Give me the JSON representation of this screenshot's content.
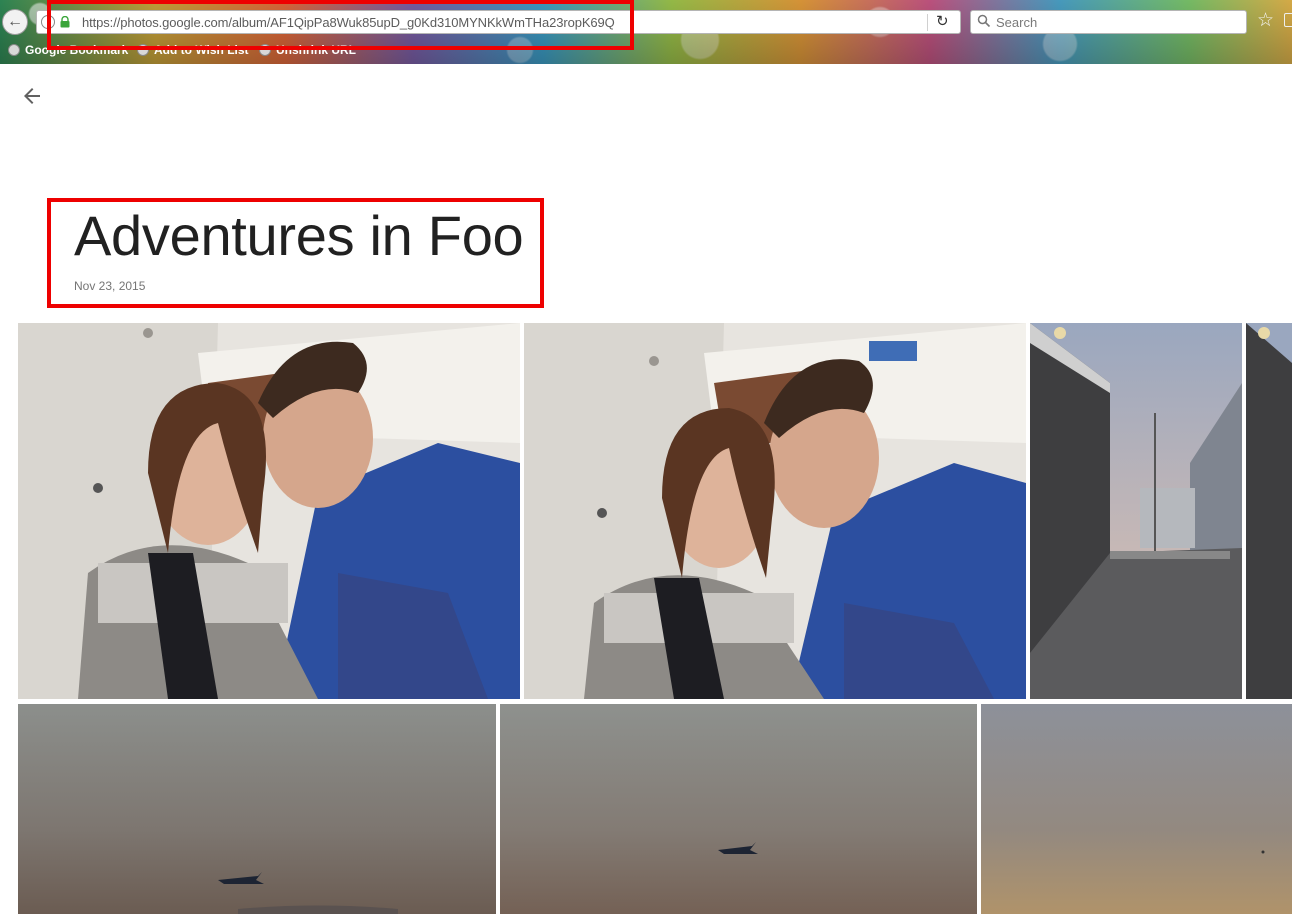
{
  "browser": {
    "url": "https://photos.google.com/album/AF1QipPa8Wuk85upD_g0Kd310MYNKkWmTHa23ropK69Q",
    "search_placeholder": "Search",
    "bookmarks": [
      {
        "label": "Google Bookmark"
      },
      {
        "label": "Add to Wish List"
      },
      {
        "label": "Unshrink URL"
      }
    ]
  },
  "album": {
    "title": "Adventures in Foo",
    "date": "Nov 23, 2015"
  },
  "photos": [
    {
      "description": "selfie-couple-train"
    },
    {
      "description": "selfie-couple-train"
    },
    {
      "description": "buildings-dusk"
    },
    {
      "description": "buildings-dusk-partial"
    },
    {
      "description": "plane-dusk-sky"
    },
    {
      "description": "plane-dusk-sky"
    },
    {
      "description": "dusk-sky"
    }
  ],
  "colors": {
    "highlight": "#ee0000",
    "title_text": "#212121",
    "date_text": "#757575"
  }
}
